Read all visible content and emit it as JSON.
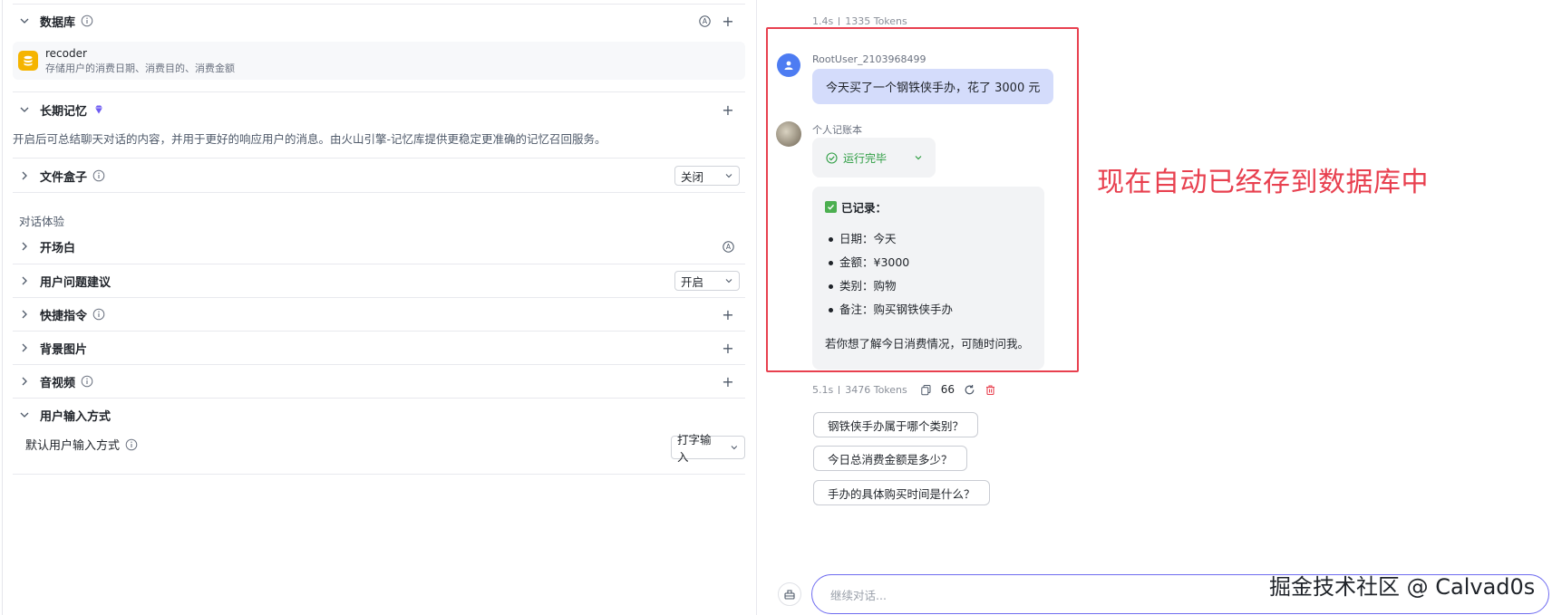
{
  "left": {
    "database": {
      "title": "数据库",
      "item": {
        "name": "recoder",
        "desc": "存储用户的消费日期、消费目的、消费金额"
      }
    },
    "memory": {
      "title": "长期记忆",
      "desc": "开启后可总结聊天对话的内容，并用于更好的响应用户的消息。由火山引擎-记忆库提供更稳定更准确的记忆召回服务。"
    },
    "filebox": {
      "title": "文件盒子",
      "value": "关闭"
    },
    "group_label": "对话体验",
    "opening": {
      "title": "开场白"
    },
    "suggest": {
      "title": "用户问题建议",
      "value": "开启"
    },
    "shortcut": {
      "title": "快捷指令"
    },
    "background": {
      "title": "背景图片"
    },
    "media": {
      "title": "音视频"
    },
    "input_method": {
      "title": "用户输入方式",
      "default_label": "默认用户输入方式",
      "value": "打字输入"
    }
  },
  "chat": {
    "prev_meta": {
      "time": "1.4s",
      "tokens": "1335 Tokens"
    },
    "user": {
      "name": "RootUser_2103968499",
      "message": "今天买了一个钢铁侠手办，花了 3000 元"
    },
    "bot": {
      "name": "个人记账本",
      "status": "运行完毕",
      "reply_header": "已记录：",
      "items": [
        "日期：今天",
        "金额：¥3000",
        "类别：购物",
        "备注：购买钢铁侠手办"
      ],
      "reply_tail": "若你想了解今日消费情况，可随时问我。"
    },
    "meta": {
      "time": "5.1s",
      "tokens": "3476 Tokens",
      "quote": "66"
    },
    "annotation": "现在自动已经存到数据库中",
    "suggestions": [
      "钢铁侠手办属于哪个类别？",
      "今日总消费金额是多少？",
      "手办的具体购买时间是什么？"
    ],
    "composer_placeholder": "继续对话...",
    "watermark": "掘金技术社区 @ Calvad0s"
  },
  "colors": {
    "accent": "#4d7cf2",
    "annotation": "#e8404f",
    "success": "#2f9e44",
    "db_icon": "#f5b400"
  }
}
